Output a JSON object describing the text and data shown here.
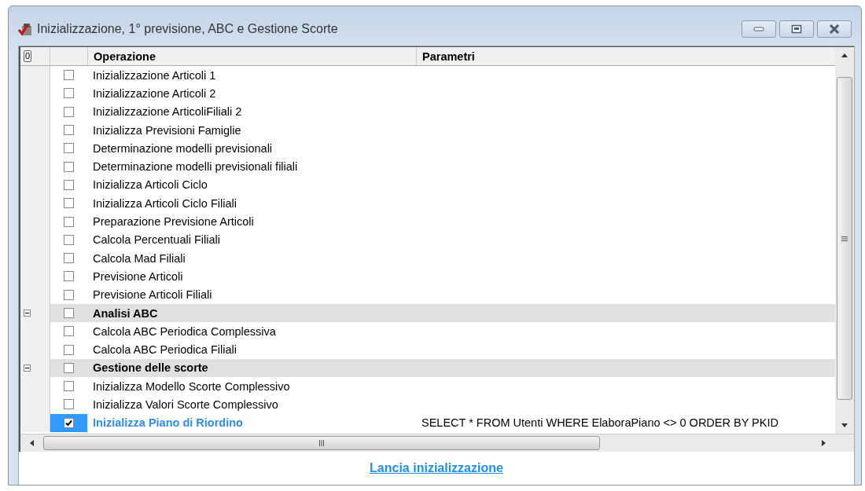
{
  "window": {
    "title": "Inizializzazione, 1° previsione, ABC e Gestione Scorte"
  },
  "grid": {
    "corner_label": "0",
    "columns": [
      "Operazione",
      "Parametri"
    ],
    "rows": [
      {
        "kind": "item",
        "checked": false,
        "selected": false,
        "operation": "Inizializzazione Articoli 1"
      },
      {
        "kind": "item",
        "checked": false,
        "selected": false,
        "operation": "Inizializzazione Articoli 2"
      },
      {
        "kind": "item",
        "checked": false,
        "selected": false,
        "operation": "Inizializzazione ArticoliFiliali 2"
      },
      {
        "kind": "item",
        "checked": false,
        "selected": false,
        "operation": "Inizializza Previsioni Famiglie"
      },
      {
        "kind": "item",
        "checked": false,
        "selected": false,
        "operation": "Determinazione modelli previsionali"
      },
      {
        "kind": "item",
        "checked": false,
        "selected": false,
        "operation": "Determinazione modelli previsionali filiali"
      },
      {
        "kind": "item",
        "checked": false,
        "selected": false,
        "operation": "Inizializza Articoli Ciclo"
      },
      {
        "kind": "item",
        "checked": false,
        "selected": false,
        "operation": "Inizializza Articoli Ciclo Filiali"
      },
      {
        "kind": "item",
        "checked": false,
        "selected": false,
        "operation": "Preparazione Previsione Articoli"
      },
      {
        "kind": "item",
        "checked": false,
        "selected": false,
        "operation": "Calcola Percentuali Filiali"
      },
      {
        "kind": "item",
        "checked": false,
        "selected": false,
        "operation": "Calcola Mad Filiali"
      },
      {
        "kind": "item",
        "checked": false,
        "selected": false,
        "operation": "Previsione Articoli"
      },
      {
        "kind": "item",
        "checked": false,
        "selected": false,
        "operation": "Previsione Articoli Filiali"
      },
      {
        "kind": "group",
        "expanded": true,
        "checked": false,
        "selected": false,
        "operation": "Analisi ABC"
      },
      {
        "kind": "item",
        "checked": false,
        "selected": false,
        "operation": "Calcola ABC Periodica Complessiva"
      },
      {
        "kind": "item",
        "checked": false,
        "selected": false,
        "operation": "Calcola ABC Periodica Filiali"
      },
      {
        "kind": "group",
        "expanded": true,
        "checked": false,
        "selected": false,
        "operation": "Gestione delle scorte"
      },
      {
        "kind": "item",
        "checked": false,
        "selected": false,
        "operation": "Inizializza Modello Scorte Complessivo"
      },
      {
        "kind": "item",
        "checked": false,
        "selected": false,
        "operation": "Inizializza Valori Scorte Complessivo"
      },
      {
        "kind": "item",
        "checked": true,
        "selected": true,
        "operation": "Inizializza Piano di Riordino",
        "parameters": "SELECT * FROM Utenti WHERE ElaboraPiano <> 0 ORDER BY PKID"
      }
    ]
  },
  "footer": {
    "link": "Lancia inizializzazione"
  }
}
